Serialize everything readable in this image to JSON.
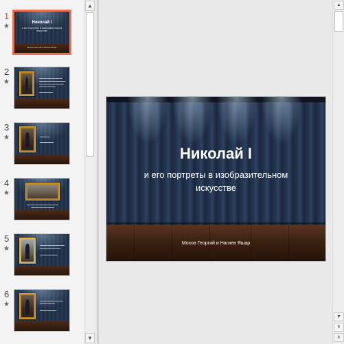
{
  "thumbnails": [
    {
      "number": "1",
      "star": "★",
      "title": "Николай I",
      "subtitle": "и его портреты в изобразительном искусстве",
      "footer": "Мохов Георгий и Нагиев Яшар"
    },
    {
      "number": "2",
      "star": "★"
    },
    {
      "number": "3",
      "star": "★"
    },
    {
      "number": "4",
      "star": "★"
    },
    {
      "number": "5",
      "star": "★"
    },
    {
      "number": "6",
      "star": "★"
    }
  ],
  "slide": {
    "title": "Николай I",
    "subtitle": "и его портреты в изобразительном искусстве",
    "author": "Мохов Георгий и Нагиев Яшар"
  },
  "scrollbars": {
    "thumb_up": "▲",
    "thumb_down": "▼",
    "main_up": "▲",
    "main_down": "▼",
    "prev_slide": "⇞",
    "next_slide": "⇟"
  },
  "colors": {
    "selected_accent": "#e8704f",
    "slide_background": "#243550"
  }
}
